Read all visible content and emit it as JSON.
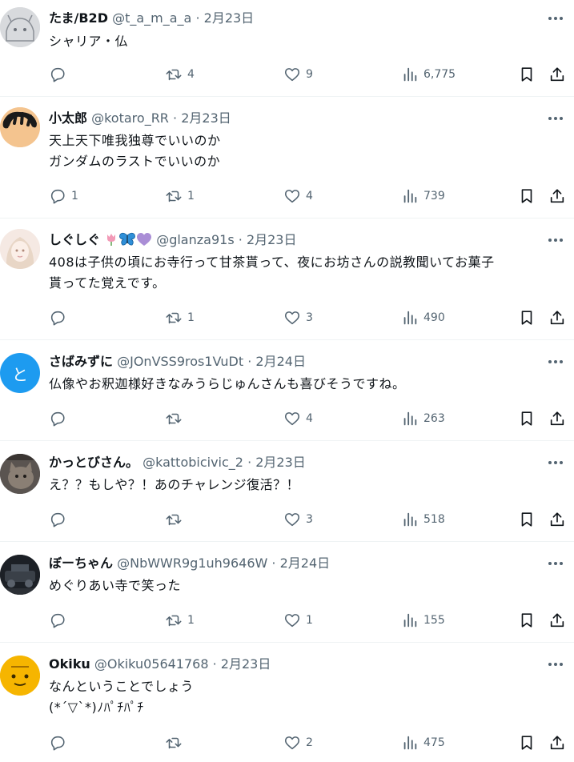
{
  "tweets": [
    {
      "name": "たま/B2D",
      "handle": "@t_a_m_a_a",
      "date": "2月23日",
      "lines": [
        "シャリア・仏"
      ],
      "replies": "",
      "retweets": "4",
      "likes": "9",
      "views": "6,775"
    },
    {
      "name": "小太郎",
      "handle": "@kotaro_RR",
      "date": "2月23日",
      "lines": [
        "天上天下唯我独尊でいいのか",
        "ガンダムのラストでいいのか"
      ],
      "replies": "1",
      "retweets": "1",
      "likes": "4",
      "views": "739"
    },
    {
      "name": "しぐしぐ",
      "handle": "@glanza91s",
      "date": "2月23日",
      "lines": [
        "408は子供の頃にお寺行って甘茶貰って、夜にお坊さんの説教聞いてお菓子",
        "貰ってた覚えです。"
      ],
      "replies": "",
      "retweets": "1",
      "likes": "3",
      "views": "490"
    },
    {
      "name": "さばみずに",
      "handle": "@JOnVSS9ros1VuDt",
      "date": "2月24日",
      "avatar_letter": "と",
      "lines": [
        "仏像やお釈迦様好きなみうらじゅんさんも喜びそうですね。"
      ],
      "replies": "",
      "retweets": "",
      "likes": "4",
      "views": "263"
    },
    {
      "name": "かっとびさん。",
      "handle": "@kattobicivic_2",
      "date": "2月23日",
      "lines": [
        "え？？もしや？！あのチャレンジ復活？！"
      ],
      "replies": "",
      "retweets": "",
      "likes": "3",
      "views": "518"
    },
    {
      "name": "ぼーちゃん",
      "handle": "@NbWWR9g1uh9646W",
      "date": "2月24日",
      "lines": [
        "めぐりあい寺で笑った"
      ],
      "replies": "",
      "retweets": "1",
      "likes": "1",
      "views": "155"
    },
    {
      "name": "Okiku",
      "handle": "@Okiku05641768",
      "date": "2月23日",
      "lines": [
        "なんということでしょう",
        "(*´▽`*)ﾉﾊﾟﾁﾊﾟﾁ"
      ],
      "replies": "",
      "retweets": "",
      "likes": "2",
      "views": "475"
    }
  ],
  "separator": "·",
  "emoji_names": [
    "tulip",
    "butterfly",
    "purple-heart"
  ],
  "colors": {
    "text": "#0f1419",
    "secondary": "#536471",
    "divider": "#eff3f4",
    "avatar_blue": "#1d9bf0"
  }
}
